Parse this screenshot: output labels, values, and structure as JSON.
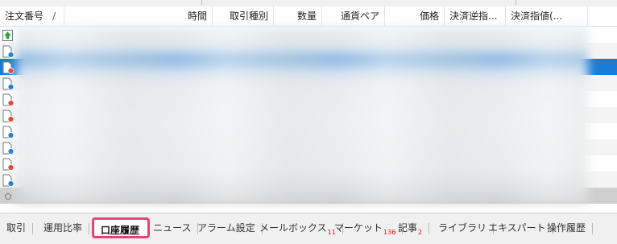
{
  "header": {
    "columns": [
      {
        "label": "注文番号"
      },
      {
        "label": "時間"
      },
      {
        "label": "取引種別"
      },
      {
        "label": "数量"
      },
      {
        "label": "通貨ペア"
      },
      {
        "label": "価格"
      },
      {
        "label": "決済逆指..."
      },
      {
        "label": "決済指値(..."
      }
    ],
    "sort_indicator": "/"
  },
  "rows": [
    {
      "icon": "up-arrow-document-icon"
    },
    {
      "icon": "blue-document-icon"
    },
    {
      "icon": "red-document-icon"
    },
    {
      "icon": "blue-document-icon"
    },
    {
      "icon": "red-document-icon"
    },
    {
      "icon": "red-document-icon"
    },
    {
      "icon": "blue-document-icon"
    },
    {
      "icon": "blue-document-icon"
    },
    {
      "icon": "red-document-icon"
    },
    {
      "icon": "blue-document-icon"
    },
    {
      "icon": "gray-circle-icon"
    }
  ],
  "tabs": [
    {
      "label": "取引"
    },
    {
      "label": "運用比率"
    },
    {
      "label": "口座履歴",
      "active": true
    },
    {
      "label": "ニュース"
    },
    {
      "label": "アラーム設定"
    },
    {
      "label": "メールボックス",
      "badge": "11"
    },
    {
      "label": "マーケット",
      "badge": "136"
    },
    {
      "label": "記事",
      "badge": "2"
    },
    {
      "label": "ライブラリ"
    },
    {
      "label": "エキスパート"
    },
    {
      "label": "操作履歴"
    }
  ],
  "colors": {
    "selected_row": "#1a7bd6",
    "active_tab_border": "#e8427a",
    "badge": "#e01010"
  }
}
